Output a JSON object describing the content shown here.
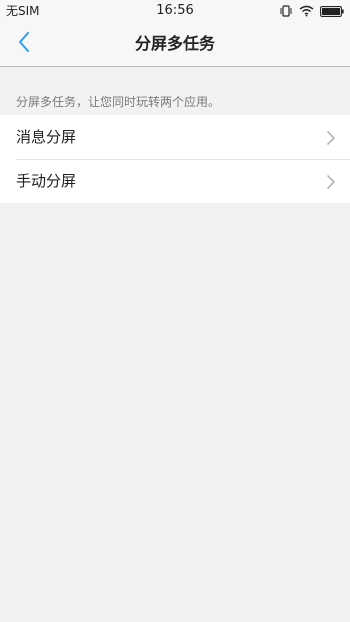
{
  "status_bar": {
    "carrier": "无SIM",
    "time": "16:56",
    "icons": [
      "vibrate-icon",
      "wifi-icon",
      "battery-icon"
    ]
  },
  "nav": {
    "back_icon": "chevron-left-icon",
    "title": "分屏多任务"
  },
  "description": "分屏多任务，让您同时玩转两个应用。",
  "items": [
    {
      "label": "消息分屏",
      "icon": "chevron-right-icon"
    },
    {
      "label": "手动分屏",
      "icon": "chevron-right-icon"
    }
  ],
  "colors": {
    "accent": "#2a9ff5",
    "background": "#f2f2f2",
    "bar": "#f7f7f7"
  }
}
